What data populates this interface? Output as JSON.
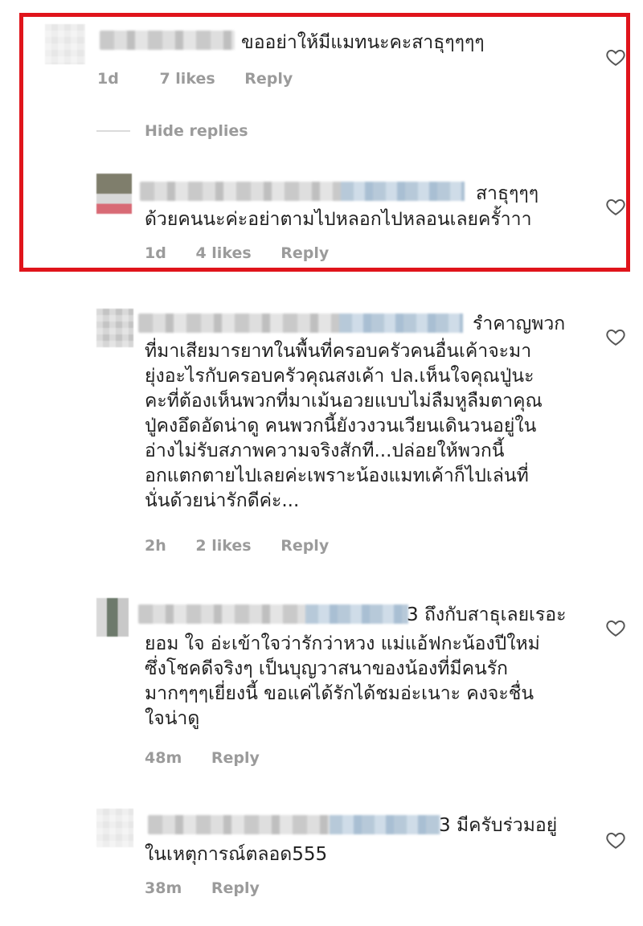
{
  "comments": [
    {
      "text": "ขออย่าให้มีแมทนะคะสาธุๆๆๆๆ",
      "age": "1d",
      "likes": "7 likes",
      "reply": "Reply"
    }
  ],
  "hide_replies": "Hide replies",
  "replies": [
    {
      "text_line1": "สาธุ​ๆๆๆ",
      "text_line2": "ด้วยคนนะค่ะอย่าตามไปหลอกไปหลอนเลยครั้าาา",
      "age": "1d",
      "likes": "4 likes",
      "reply": "Reply"
    }
  ],
  "more_comments": [
    {
      "first_line": "รำคาญพวก",
      "lines": [
        "ที่มาเสียมารยาทในพื้นที่ครอบครัวคนอื่นเค้าจะมา",
        "ยุ่งอะไรกับครอบครัวคุณสงเค้า ปล.เห็นใจคุณปู่นะ",
        "คะที่ต้องเห็นพวกที่มาเม้นอวยแบบไม่ลืมหูลืมตาคุณ",
        "ปู่คงอึดอัดน่าดู คนพวกนี้ยังวงวนเวียนเดินวนอยู่ใน",
        "อ่างไม่รับสภาพความจริงสักที...ปล่อยให้พวกนี้",
        "อกแตกตายไปเลยค่ะเพราะน้องแมทเค้าก็ไปเล่นที่",
        "นั่นด้วยน่ารักดีค่ะ..."
      ],
      "age": "2h",
      "likes": "2 likes",
      "reply": "Reply"
    },
    {
      "first_line": "3 ถึงกับสาธุเลยเรอะ",
      "lines": [
        "ยอม ใจ อ่ะเข้าใจว่ารักว่าหวง แม่แอ้ฟกะน้องปีใหม่",
        "ซึ่งโชคดีจริงๆ เป็นบุญวาสนาของน้องที่มีคนรัก",
        "มากๆๆๆเยี่ยงนี้ ขอแค่ได้รักได้ชมอ่ะเนาะ คงจะชื่น",
        "ใจน่าดู"
      ],
      "age": "48m",
      "reply": "Reply"
    },
    {
      "first_line": "3 มีครับร่วมอยู่",
      "lines": [
        "ในเหตุการณ์ตลอด555"
      ],
      "age": "38m",
      "reply": "Reply"
    }
  ],
  "colors": {
    "highlight_border": "#e0141b",
    "meta_text": "#9b9b9b",
    "body_text": "#1f1f1f"
  },
  "icons": {
    "like": "heart-outline-icon"
  }
}
